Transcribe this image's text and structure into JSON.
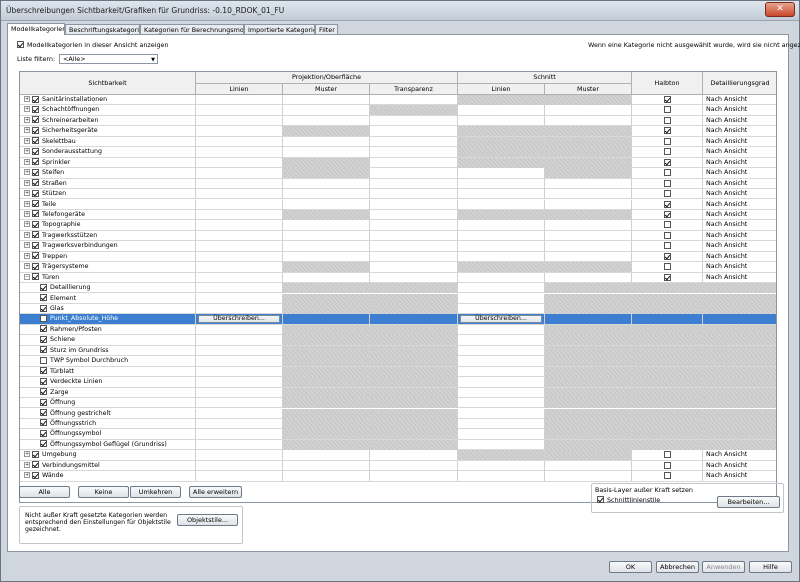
{
  "window": {
    "title": "Überschreibungen Sichtbarkeit/Grafiken für Grundriss: -0.10_RDOK_01_FU",
    "close": "✕"
  },
  "tabs": [
    "Modellkategorien",
    "Beschriftungskategorien",
    "Kategorien für Berechnungsmodell",
    "Importierte Kategorien",
    "Filter"
  ],
  "show_model_categories": "Modellkategorien in dieser Ansicht anzeigen",
  "note": "Wenn eine Kategorie nicht ausgewählt wurde, wird sie nicht angezeigt.",
  "filter": {
    "label": "Liste filtern:",
    "value": "<Alle>"
  },
  "headers": {
    "visibility": "Sichtbarkeit",
    "projection": "Projektion/Oberfläche",
    "cut": "Schnitt",
    "halftone": "Halbton",
    "detail": "Detaillierungsgrad",
    "lines": "Linien",
    "pattern": "Muster",
    "transparency": "Transparenz"
  },
  "override_label": "Überschreiben...",
  "rows": [
    {
      "name": "Sanitärinstallationen",
      "level": 0,
      "checked": true,
      "halftone": true,
      "detail": "Nach Ansicht",
      "gray": "cut"
    },
    {
      "name": "Schachtöffnungen",
      "level": 0,
      "checked": true,
      "halftone": false,
      "detail": "Nach Ansicht",
      "gray": "trans"
    },
    {
      "name": "Schreinerarbeiten",
      "level": 0,
      "checked": true,
      "halftone": false,
      "detail": "Nach Ansicht",
      "gray": ""
    },
    {
      "name": "Sicherheitsgeräte",
      "level": 0,
      "checked": true,
      "halftone": true,
      "detail": "Nach Ansicht",
      "gray": "pat_cut"
    },
    {
      "name": "Skelettbau",
      "level": 0,
      "checked": true,
      "halftone": false,
      "detail": "Nach Ansicht",
      "gray": "cut"
    },
    {
      "name": "Sonderausstattung",
      "level": 0,
      "checked": true,
      "halftone": false,
      "detail": "Nach Ansicht",
      "gray": "cut"
    },
    {
      "name": "Sprinkler",
      "level": 0,
      "checked": true,
      "halftone": true,
      "detail": "Nach Ansicht",
      "gray": "pat_cut"
    },
    {
      "name": "Steifen",
      "level": 0,
      "checked": true,
      "halftone": false,
      "detail": "Nach Ansicht",
      "gray": "pat_cutpat"
    },
    {
      "name": "Straßen",
      "level": 0,
      "checked": true,
      "halftone": false,
      "detail": "Nach Ansicht",
      "gray": ""
    },
    {
      "name": "Stützen",
      "level": 0,
      "checked": true,
      "halftone": false,
      "detail": "Nach Ansicht",
      "gray": ""
    },
    {
      "name": "Teile",
      "level": 0,
      "checked": true,
      "halftone": true,
      "detail": "Nach Ansicht",
      "gray": ""
    },
    {
      "name": "Telefongeräte",
      "level": 0,
      "checked": true,
      "halftone": true,
      "detail": "Nach Ansicht",
      "gray": "pat_cut"
    },
    {
      "name": "Topographie",
      "level": 0,
      "checked": true,
      "halftone": false,
      "detail": "Nach Ansicht",
      "gray": ""
    },
    {
      "name": "Tragwerksstützen",
      "level": 0,
      "checked": true,
      "halftone": false,
      "detail": "Nach Ansicht",
      "gray": ""
    },
    {
      "name": "Tragwerksverbindungen",
      "level": 0,
      "checked": true,
      "halftone": false,
      "detail": "Nach Ansicht",
      "gray": ""
    },
    {
      "name": "Treppen",
      "level": 0,
      "checked": true,
      "halftone": true,
      "detail": "Nach Ansicht",
      "gray": ""
    },
    {
      "name": "Trägersysteme",
      "level": 0,
      "checked": true,
      "halftone": false,
      "detail": "Nach Ansicht",
      "gray": "pat_cut"
    },
    {
      "name": "Türen",
      "level": 0,
      "checked": true,
      "halftone": true,
      "detail": "Nach Ansicht",
      "gray": "",
      "expanded": true
    },
    {
      "name": "Detaillierung",
      "level": 1,
      "checked": true,
      "gray": "sub"
    },
    {
      "name": "Element",
      "level": 1,
      "checked": true,
      "gray": "sub"
    },
    {
      "name": "Glas",
      "level": 1,
      "checked": true,
      "gray": "sub"
    },
    {
      "name": "Punkt_Absolute_Höhe",
      "level": 1,
      "checked": false,
      "gray": "sub",
      "selected": true
    },
    {
      "name": "Rahmen/Pfosten",
      "level": 1,
      "checked": true,
      "gray": "sub"
    },
    {
      "name": "Schiene",
      "level": 1,
      "checked": true,
      "gray": "sub"
    },
    {
      "name": "Sturz im Grundriss",
      "level": 1,
      "checked": true,
      "gray": "sub"
    },
    {
      "name": "TWP Symbol Durchbruch",
      "level": 1,
      "checked": false,
      "gray": "sub"
    },
    {
      "name": "Türblatt",
      "level": 1,
      "checked": true,
      "gray": "sub"
    },
    {
      "name": "Verdeckte Linien",
      "level": 1,
      "checked": true,
      "gray": "sub"
    },
    {
      "name": "Zarge",
      "level": 1,
      "checked": true,
      "gray": "sub"
    },
    {
      "name": "Öffnung",
      "level": 1,
      "checked": true,
      "gray": "sub"
    },
    {
      "name": "Öffnung gestrichelt",
      "level": 1,
      "checked": true,
      "gray": "sub"
    },
    {
      "name": "Öffnungsstrich",
      "level": 1,
      "checked": true,
      "gray": "sub"
    },
    {
      "name": "Öffnungssymbol",
      "level": 1,
      "checked": true,
      "gray": "sub"
    },
    {
      "name": "Öffnungssymbol Geflügel (Grundriss)",
      "level": 1,
      "checked": true,
      "gray": "sub"
    },
    {
      "name": "Umgebung",
      "level": 0,
      "checked": true,
      "halftone": false,
      "detail": "Nach Ansicht",
      "gray": "cut"
    },
    {
      "name": "Verbindungsmittel",
      "level": 0,
      "checked": true,
      "halftone": false,
      "detail": "Nach Ansicht",
      "gray": ""
    },
    {
      "name": "Wände",
      "level": 0,
      "checked": true,
      "halftone": false,
      "detail": "Nach Ansicht",
      "gray": ""
    }
  ],
  "buttons": {
    "all": "Alle",
    "none": "Keine",
    "invert": "Umkehren",
    "expand_all": "Alle erweitern",
    "object_styles": "Objektstile...",
    "edit": "Bearbeiten...",
    "ok": "OK",
    "cancel": "Abbrechen",
    "apply": "Anwenden",
    "help": "Hilfe"
  },
  "info_text": "Nicht außer Kraft gesetzte Kategorien werden entsprechend den Einstellungen für Objektstile gezeichnet.",
  "base_layer": {
    "title": "Basis-Layer außer Kraft setzen",
    "cut_line_styles": "Schnittlinienstile"
  }
}
